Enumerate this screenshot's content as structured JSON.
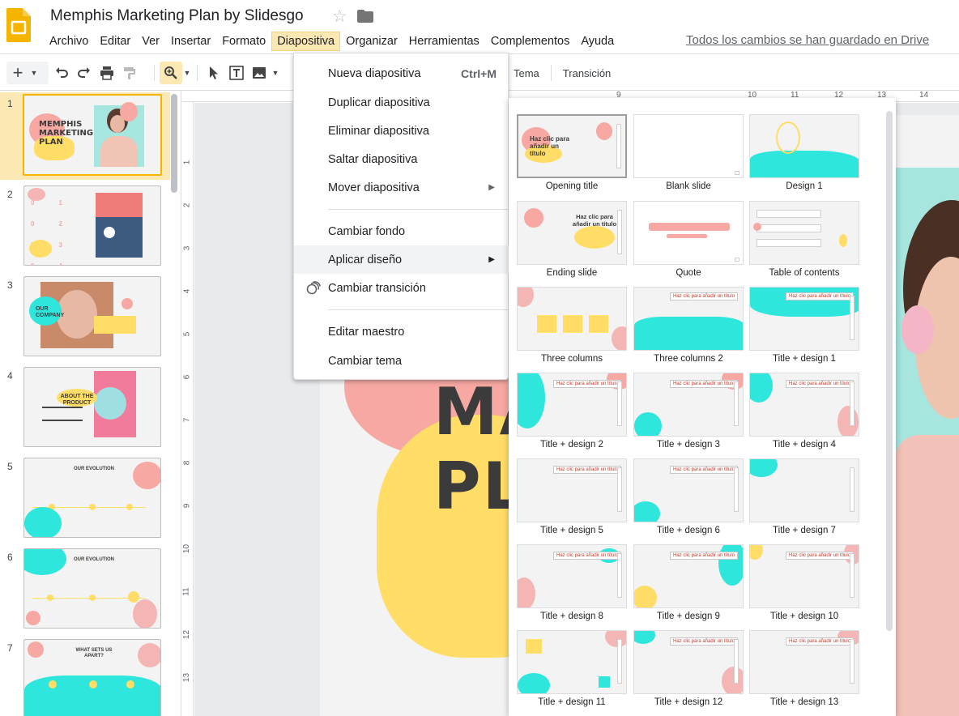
{
  "app": {
    "title": "Memphis Marketing Plan by Slidesgo",
    "save_status": "Todos los cambios se han guardado en Drive"
  },
  "menubar": {
    "items": [
      "Archivo",
      "Editar",
      "Ver",
      "Insertar",
      "Formato",
      "Diapositiva",
      "Organizar",
      "Herramientas",
      "Complementos",
      "Ayuda"
    ],
    "active": "Diapositiva"
  },
  "toolbar": {
    "theme_label": "Tema",
    "transition_label": "Transición"
  },
  "slide_menu": {
    "items": [
      {
        "label": "Nueva diapositiva",
        "shortcut": "Ctrl+M"
      },
      {
        "label": "Duplicar diapositiva"
      },
      {
        "label": "Eliminar diapositiva"
      },
      {
        "label": "Saltar diapositiva"
      },
      {
        "label": "Mover diapositiva",
        "submenu": true
      },
      {
        "label": "Cambiar fondo"
      },
      {
        "label": "Aplicar diseño",
        "submenu": true,
        "highlighted": true
      },
      {
        "label": "Cambiar transición",
        "icon": "transition-icon"
      },
      {
        "label": "Editar maestro"
      },
      {
        "label": "Cambiar tema"
      }
    ]
  },
  "layouts": [
    {
      "label": "Opening title",
      "selected": true
    },
    {
      "label": "Blank slide"
    },
    {
      "label": "Design 1"
    },
    {
      "label": "Ending slide"
    },
    {
      "label": "Quote"
    },
    {
      "label": "Table of contents"
    },
    {
      "label": "Three columns"
    },
    {
      "label": "Three columns 2"
    },
    {
      "label": "Title + design 1"
    },
    {
      "label": "Title + design 2"
    },
    {
      "label": "Title + design 3"
    },
    {
      "label": "Title + design 4"
    },
    {
      "label": "Title + design 5"
    },
    {
      "label": "Title + design 6"
    },
    {
      "label": "Title + design 7"
    },
    {
      "label": "Title + design 8"
    },
    {
      "label": "Title + design 9"
    },
    {
      "label": "Title + design 10"
    },
    {
      "label": "Title + design 11"
    },
    {
      "label": "Title + design 12"
    },
    {
      "label": "Title + design 13"
    }
  ],
  "layout_thumb_texts": {
    "opening": "Haz clic para añadir un título",
    "ending": "Haz clic para añadir un título",
    "small": "Haz clic para añadir un título"
  },
  "slides": [
    {
      "num": "1",
      "text": "MEMPHIS MARKETING PLAN",
      "selected": true
    },
    {
      "num": "2",
      "text": "01 02 03 04"
    },
    {
      "num": "3",
      "text": "OUR COMPANY"
    },
    {
      "num": "4",
      "text": "ABOUT THE PRODUCT"
    },
    {
      "num": "5",
      "text": "OUR EVOLUTION"
    },
    {
      "num": "6",
      "text": "OUR EVOLUTION"
    },
    {
      "num": "7",
      "text": "WHAT SETS US APART?"
    }
  ],
  "main_slide": {
    "line1": "MA",
    "line2": "PL"
  },
  "rulers": {
    "top": [
      "9",
      "10",
      "11",
      "12",
      "13",
      "14"
    ],
    "left": [
      "1",
      "2",
      "3",
      "4",
      "5",
      "6",
      "7",
      "8",
      "9",
      "10",
      "11",
      "12",
      "13"
    ]
  },
  "colors": {
    "accent_yellow": "#fce8b2",
    "coral": "#f7a8a2",
    "teal": "#2ee6dc",
    "yellow": "#ffdd66",
    "pink": "#f4b6b5"
  }
}
